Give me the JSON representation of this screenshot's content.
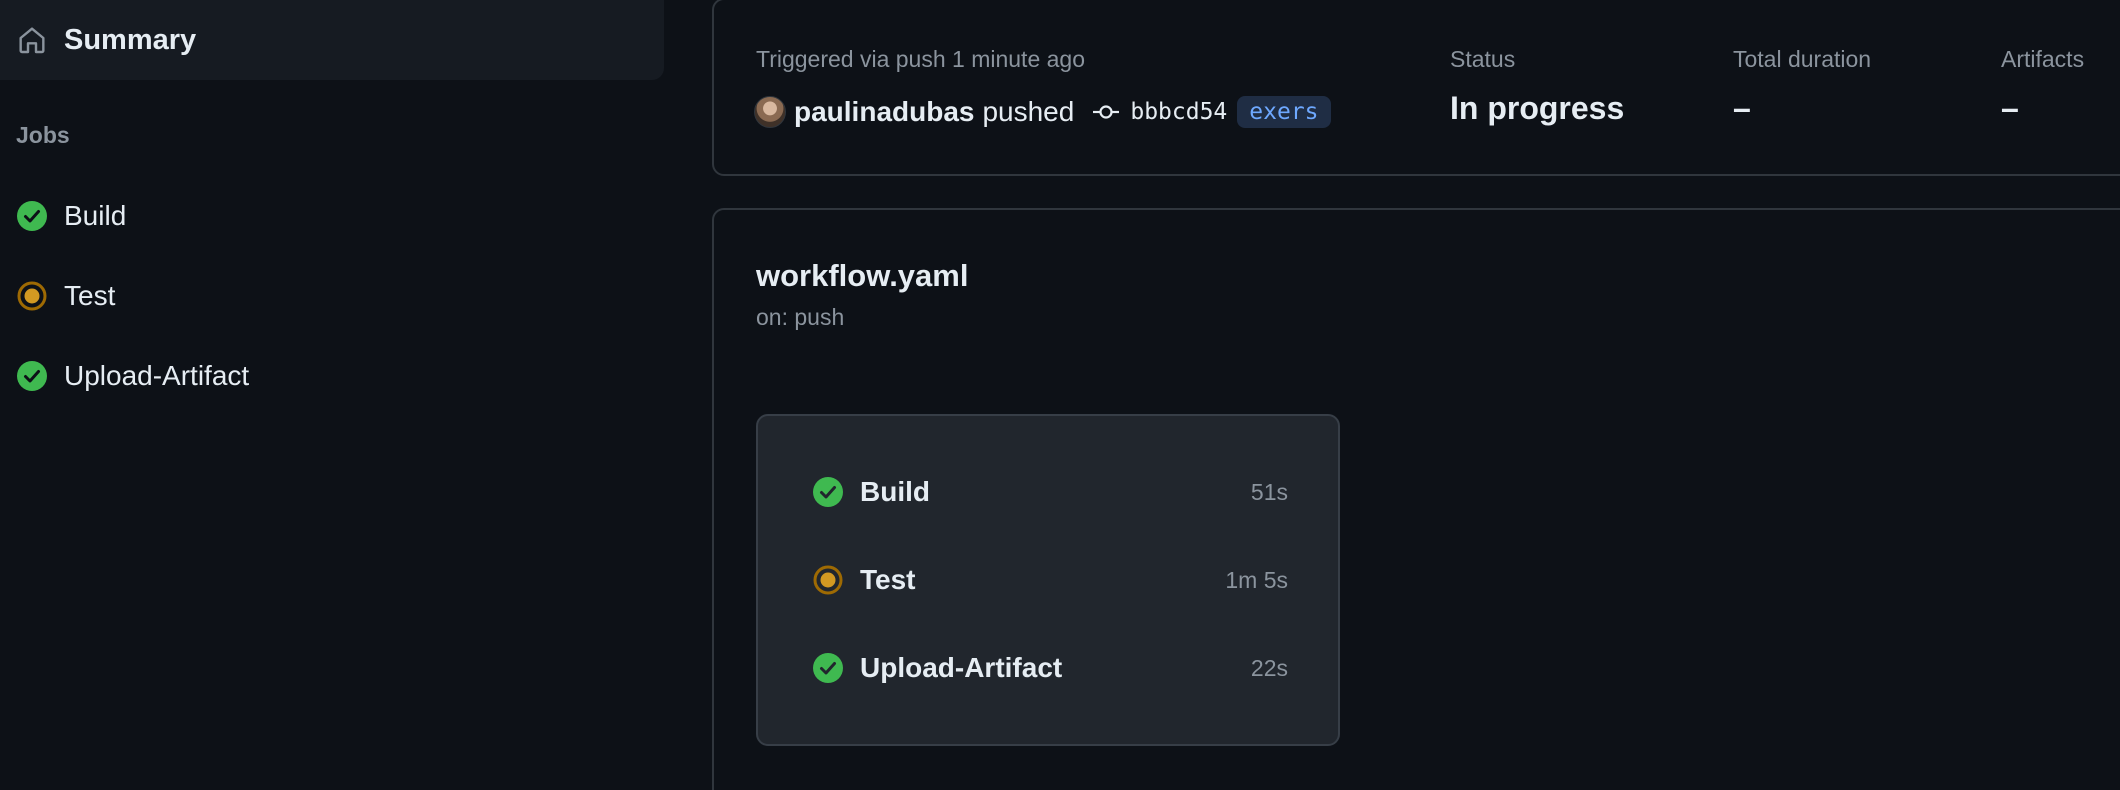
{
  "sidebar": {
    "summary": {
      "label": "Summary",
      "icon": "home-icon"
    },
    "jobs_heading": "Jobs",
    "jobs": [
      {
        "label": "Build",
        "status": "success",
        "icon": "check-circle-icon"
      },
      {
        "label": "Test",
        "status": "in_progress",
        "icon": "in-progress-icon"
      },
      {
        "label": "Upload-Artifact",
        "status": "success",
        "icon": "check-circle-icon"
      }
    ]
  },
  "run_info": {
    "triggered_text": "Triggered via push 1 minute ago",
    "actor": "paulinadubas",
    "action": "pushed",
    "commit_sha": "bbbcd54",
    "branch": "exers",
    "status_label": "Status",
    "status_value": "In progress",
    "duration_label": "Total duration",
    "duration_value": "–",
    "artifacts_label": "Artifacts",
    "artifacts_value": "–"
  },
  "workflow": {
    "file_name": "workflow.yaml",
    "trigger": "on: push",
    "jobs": [
      {
        "name": "Build",
        "duration": "51s",
        "status": "success"
      },
      {
        "name": "Test",
        "duration": "1m 5s",
        "status": "in_progress"
      },
      {
        "name": "Upload-Artifact",
        "duration": "22s",
        "status": "success"
      }
    ]
  },
  "colors": {
    "background": "#0d1117",
    "panel": "#161b22",
    "border": "#30363d",
    "success": "#3fb950",
    "in_progress": "#d29922",
    "muted_text": "#8b949e",
    "branch_text": "#6ea8fe"
  }
}
